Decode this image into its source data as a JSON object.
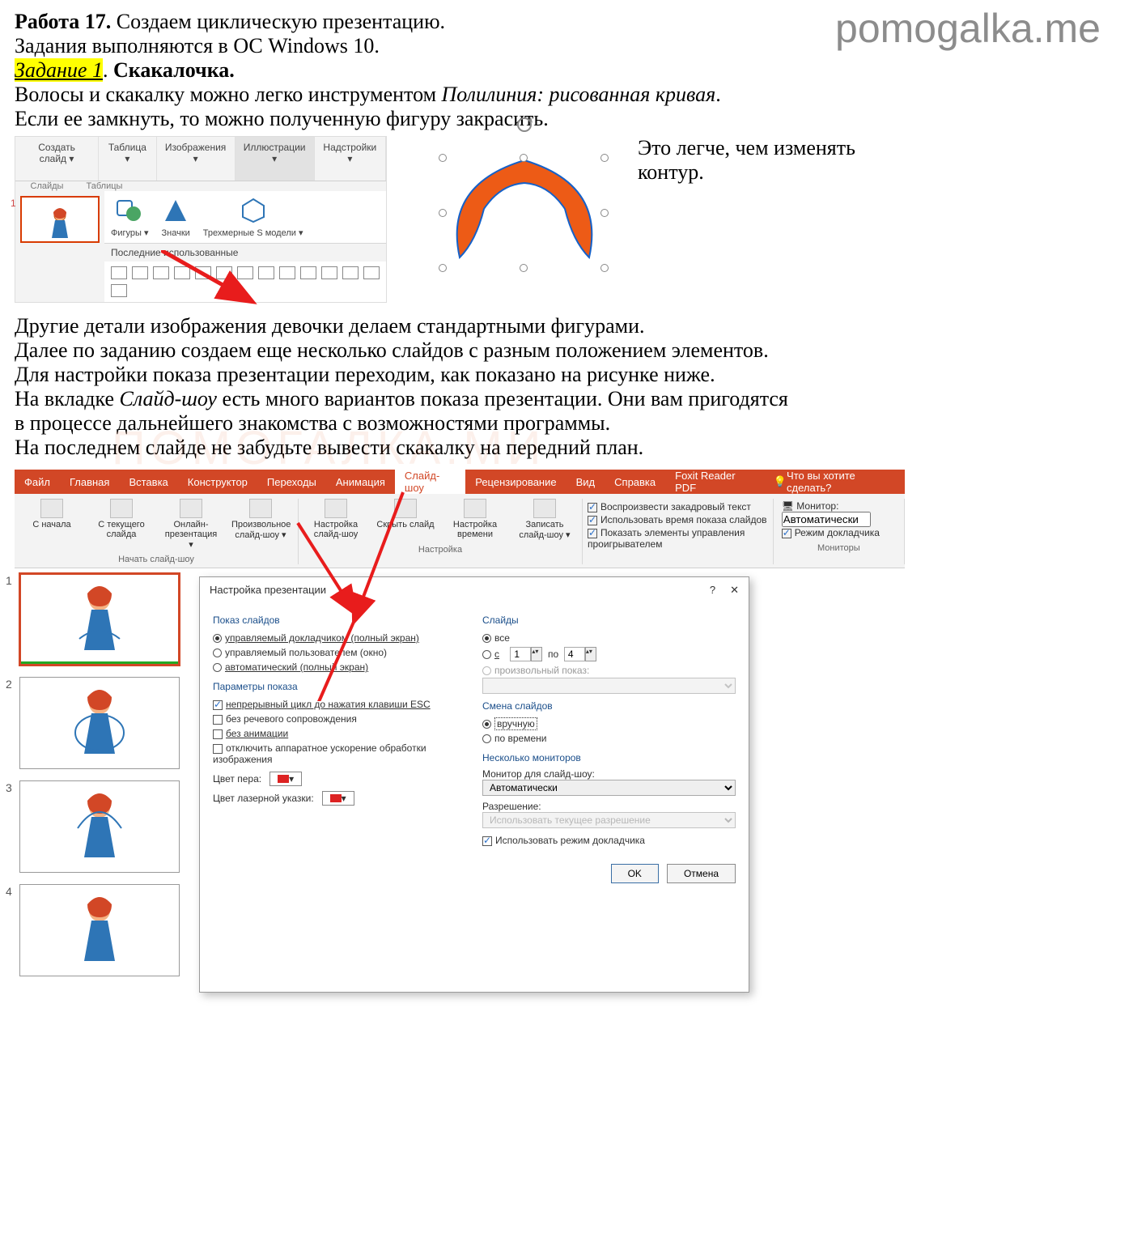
{
  "watermark": "pomogalka.me",
  "heading": {
    "work_label": "Работа 17.",
    "work_title": "Создаем циклическую презентацию.",
    "os_line": "Задания выполняются в ОС Windows 10.",
    "task_label": "Задание 1",
    "task_name": "Скакалочка."
  },
  "para1_a": "Волосы и скакалку можно легко инструментом ",
  "para1_tool": "Полилиния: рисованная кривая",
  "para1_b": ".",
  "para1_c": "Если ее замкнуть, то можно полученную фигуру закрасить.",
  "side_note_1": "Это легче, чем изменять",
  "side_note_2": "контур.",
  "ribbon_small": {
    "buttons": [
      "Создать слайд ▾",
      "Таблица ▾",
      "Изображения ▾",
      "Иллюстрации ▾",
      "Надстройки ▾"
    ],
    "group_labels": [
      "Слайды",
      "Таблицы"
    ],
    "shapes_row": {
      "figury": "Фигуры ▾",
      "znachki": "Значки",
      "models": "Трехмерные S модели ▾"
    },
    "recent_label": "Последние использованные"
  },
  "para2": [
    "Другие детали изображения девочки делаем стандартными фигурами.",
    "Далее по заданию создаем еще несколько слайдов с разным положением элементов.",
    "Для настройки показа презентации переходим, как показано на рисунке ниже.",
    "На вкладке Слайд-шоу есть много вариантов показа презентации. Они вам пригодятся",
    "в процессе дальнейшего знакомства с возможностями программы.",
    "На последнем слайде не забудьте вывести скакалку на передний план."
  ],
  "para2_italic_idx": 3,
  "pp_big": {
    "tabs": [
      "Файл",
      "Главная",
      "Вставка",
      "Конструктор",
      "Переходы",
      "Анимация",
      "Слайд-шоу",
      "Рецензирование",
      "Вид",
      "Справка",
      "Foxit Reader PDF"
    ],
    "tell_me": "Что вы хотите сделать?",
    "group1": {
      "btns": [
        "С начала",
        "С текущего слайда",
        "Онлайн-презентация ▾",
        "Произвольное слайд-шоу ▾"
      ],
      "label": "Начать слайд-шоу"
    },
    "group2": {
      "btns": [
        "Настройка слайд-шоу",
        "Скрыть слайд",
        "Настройка времени",
        "Записать слайд-шоу ▾"
      ],
      "checks": [
        "Воспроизвести закадровый текст",
        "Использовать время показа слайдов",
        "Показать элементы управления проигрывателем"
      ],
      "label": "Настройка"
    },
    "group3": {
      "monitor_label": "Монитор:",
      "monitor_value": "Автоматически",
      "presenter": "Режим докладчика",
      "label": "Мониторы"
    },
    "slide_numbers": [
      "1",
      "2",
      "3",
      "4"
    ]
  },
  "dialog": {
    "title": "Настройка презентации",
    "help": "?",
    "close": "✕",
    "left": {
      "g1": "Показ слайдов",
      "r1": "управляемый докладчиком (полный экран)",
      "r2": "управляемый пользователем (окно)",
      "r3": "автоматический (полный экран)",
      "g2": "Параметры показа",
      "c1": "непрерывный цикл до нажатия клавиши ESC",
      "c2": "без речевого сопровождения",
      "c3": "без анимации",
      "c4": "отключить аппаратное ускорение обработки изображения",
      "pen_label": "Цвет пера:",
      "laser_label": "Цвет лазерной указки:"
    },
    "right": {
      "g1": "Слайды",
      "r_all": "все",
      "r_from": "с",
      "from_val": "1",
      "to_label": "по",
      "to_val": "4",
      "r_custom": "произвольный показ:",
      "g2": "Смена слайдов",
      "r_manual": "вручную",
      "r_time": "по времени",
      "g3": "Несколько мониторов",
      "mon_label": "Монитор для слайд-шоу:",
      "mon_val": "Автоматически",
      "res_label": "Разрешение:",
      "res_val": "Использовать текущее разрешение",
      "use_presenter": "Использовать режим докладчика"
    },
    "ok": "OK",
    "cancel": "Отмена"
  }
}
